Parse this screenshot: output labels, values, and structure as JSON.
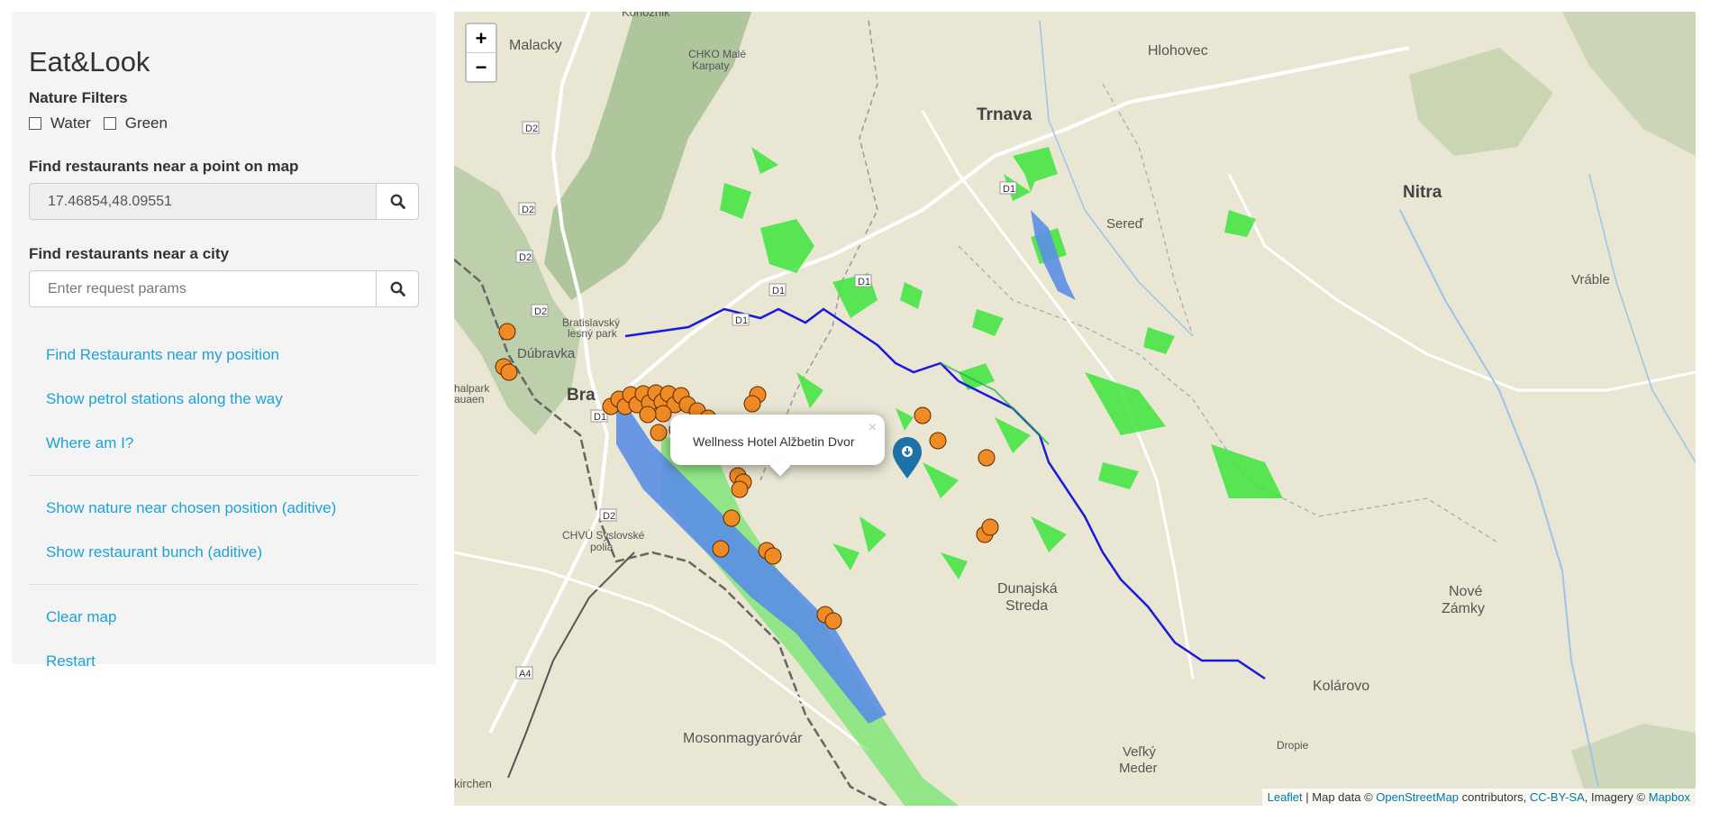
{
  "app": {
    "title": "Eat&Look"
  },
  "filters": {
    "title": "Nature Filters",
    "water_label": "Water",
    "green_label": "Green"
  },
  "point_search": {
    "title": "Find restaurants near a point on map",
    "value": "17.46854,48.09551"
  },
  "city_search": {
    "title": "Find restaurants near a city",
    "placeholder": "Enter request params"
  },
  "actions": {
    "near_position": "Find Restaurants near my position",
    "petrol_stations": "Show petrol stations along the way",
    "where_am_i": "Where am I?",
    "show_nature": "Show nature near chosen position (aditive)",
    "restaurant_bunch": "Show restaurant bunch (aditive)",
    "clear_map": "Clear map",
    "restart": "Restart"
  },
  "map": {
    "zoom_in": "+",
    "zoom_out": "−",
    "popup_text": "Wellness Hotel Alžbetin Dvor",
    "popup_close": "×",
    "attribution": {
      "leaflet": "Leaflet",
      "sep1": " | Map data © ",
      "osm": "OpenStreetMap",
      "sep2": " contributors, ",
      "license": "CC-BY-SA",
      "sep3": ", Imagery © ",
      "imagery": "Mapbox"
    },
    "places": {
      "konoznik": "Konoznik",
      "malacky": "Malacky",
      "chko_1": "CHKO Malé",
      "chko_2": "Karpaty",
      "hlohovec": "Hlohovec",
      "trnava": "Trnava",
      "nitra": "Nitra",
      "sered": "Sereď",
      "vrable": "Vráble",
      "dubravka": "Dúbravka",
      "bratislava": "Bra",
      "blesny_1": "Bratislavský",
      "blesny_2": "lesný park",
      "halpark": "halpark",
      "auaen": "auaen",
      "chvu_1": "CHVÚ Syslovské",
      "chvu_2": "polia",
      "dunajska_1": "Dunajská",
      "dunajska_2": "Streda",
      "nove_1": "Nové",
      "nove_2": "Zámky",
      "kolarovo": "Kolárovo",
      "mosonmagyarovar": "Mosonmagyaróvár",
      "velky_1": "Veľký",
      "velky_2": "Meder",
      "drope": "Dropie",
      "kirchen": "kirchen"
    },
    "roads": [
      "D2",
      "D2",
      "D2",
      "D2",
      "D1",
      "D1",
      "D1",
      "D1",
      "D1",
      "D2",
      "A4"
    ],
    "colors": {
      "restaurant_marker": "#f08a24",
      "water": "#5b8ee6",
      "green": "#3ee63e",
      "river": "#1a1adc",
      "marker_pin": "#1d73a8"
    }
  }
}
